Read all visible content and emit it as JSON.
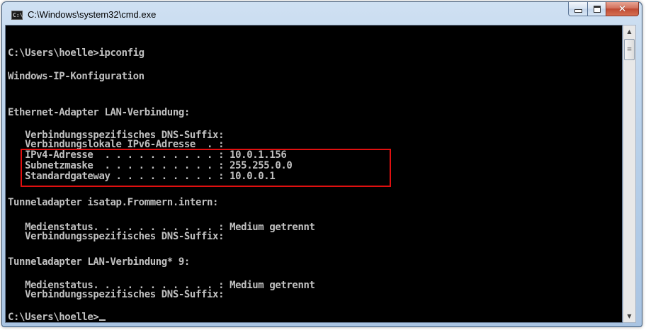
{
  "window": {
    "title": "C:\\Windows\\system32\\cmd.exe",
    "icon_text": "C:\\",
    "buttons": {
      "minimize": "minimize-icon",
      "maximize": "maximize-icon",
      "close": "close-icon"
    },
    "close_color": "#c9462f"
  },
  "console": {
    "background": "#000000",
    "foreground": "#c0c0c0",
    "lines": [
      "C:\\Users\\hoelle>ipconfig",
      "Windows-IP-Konfiguration",
      "Ethernet-Adapter LAN-Verbindung:",
      "   Verbindungsspezifisches DNS-Suffix:",
      "   Verbindungslokale IPv6-Adresse  . :",
      "   IPv4-Adresse  . . . . . . . . . . : 10.0.1.156",
      "   Subnetzmaske  . . . . . . . . . . : 255.255.0.0",
      "   Standardgateway . . . . . . . . . : 10.0.0.1",
      "Tunneladapter isatap.Frommern.intern:",
      "   Medienstatus. . . . . . . . . . . : Medium getrennt",
      "   Verbindungsspezifisches DNS-Suffix:",
      "Tunneladapter LAN-Verbindung* 9:",
      "   Medienstatus. . . . . . . . . . . : Medium getrennt",
      "   Verbindungsspezifisches DNS-Suffix:",
      "C:\\Users\\hoelle>"
    ],
    "highlight_color": "#e01010"
  },
  "scrollbar": {
    "up": "scroll-up-icon",
    "down": "scroll-down-icon",
    "grip": "grip-icon"
  }
}
